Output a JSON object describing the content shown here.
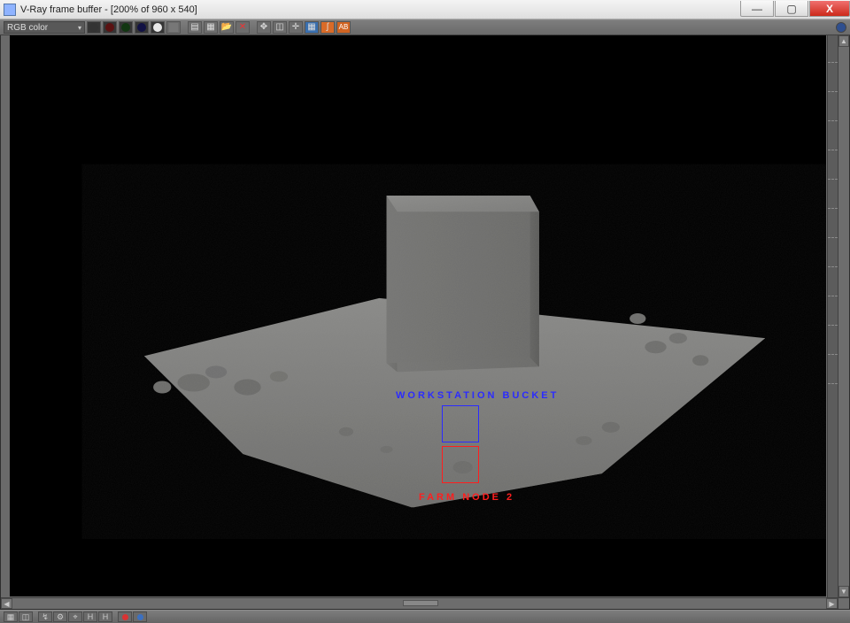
{
  "window": {
    "title": "V-Ray frame buffer - [200% of 960 x 540]"
  },
  "toolbar": {
    "channel_label": "RGB color",
    "buttons": {
      "rgb_on": "rgb-view",
      "red": "red-channel",
      "green": "green-channel",
      "blue": "blue-channel",
      "alpha": "alpha-channel",
      "mono": "mono",
      "swap": "swap-ab",
      "save": "save",
      "open": "open",
      "erase": "clear",
      "close": "×",
      "link": "link",
      "region": "region",
      "track": "track-mouse",
      "cc_curve": "color-corrections",
      "cc_gamma": "gamma-curve",
      "cc_srgb": "sRGB",
      "overlay": "overlay-text"
    }
  },
  "annotations": {
    "workstation": "WORKSTATION BUCKET",
    "farm_node": "FARM NODE 2"
  },
  "statusbar": {
    "icons": [
      "snap",
      "view",
      "link",
      "channels",
      "grid",
      "histogram",
      "h2",
      "red",
      "blue"
    ]
  }
}
